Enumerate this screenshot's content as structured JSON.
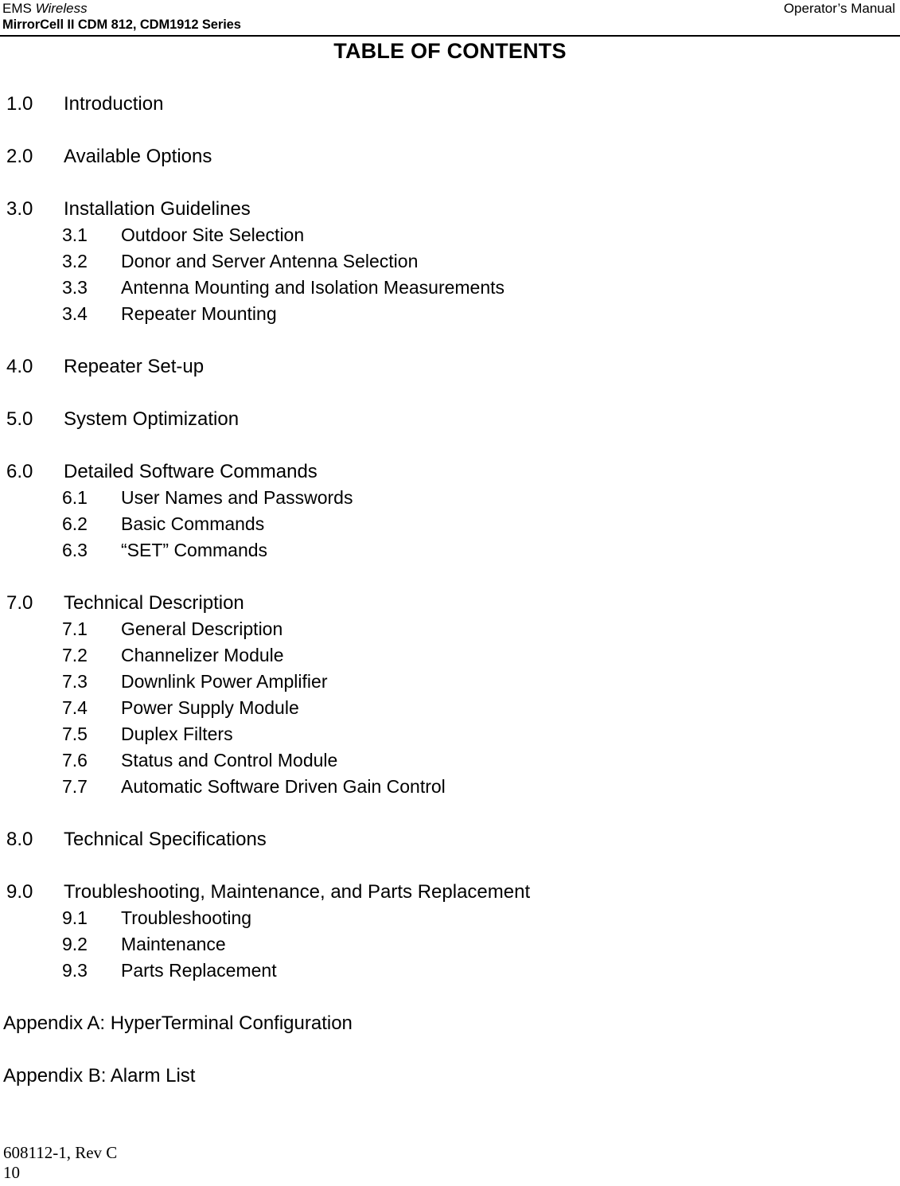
{
  "header": {
    "company_prefix": "EMS ",
    "company_italic": "Wireless",
    "product_line": "MirrorCell II CDM 812, CDM1912 Series",
    "manual_type": "Operator’s Manual"
  },
  "title": "TABLE OF CONTENTS",
  "toc": {
    "groups": [
      {
        "entries": [
          {
            "level": 1,
            "num": "1.0",
            "label": "Introduction"
          }
        ]
      },
      {
        "entries": [
          {
            "level": 1,
            "num": "2.0",
            "label": "Available Options"
          }
        ]
      },
      {
        "entries": [
          {
            "level": 1,
            "num": "3.0",
            "label": "Installation Guidelines"
          },
          {
            "level": 2,
            "num": "3.1",
            "label": "Outdoor Site Selection"
          },
          {
            "level": 2,
            "num": "3.2",
            "label": "Donor and Server Antenna Selection"
          },
          {
            "level": 2,
            "num": "3.3",
            "label": "Antenna Mounting and Isolation Measurements"
          },
          {
            "level": 2,
            "num": "3.4",
            "label": "Repeater Mounting"
          }
        ]
      },
      {
        "entries": [
          {
            "level": 1,
            "num": "4.0",
            "label": "Repeater Set-up"
          }
        ]
      },
      {
        "entries": [
          {
            "level": 1,
            "num": "5.0",
            "label": "System Optimization"
          }
        ]
      },
      {
        "entries": [
          {
            "level": 1,
            "num": "6.0",
            "label": "Detailed Software Commands"
          },
          {
            "level": 2,
            "num": "6.1",
            "label": "User Names and Passwords"
          },
          {
            "level": 2,
            "num": "6.2",
            "label": "Basic Commands"
          },
          {
            "level": 2,
            "num": "6.3",
            "label": "“SET” Commands"
          }
        ]
      },
      {
        "entries": [
          {
            "level": 1,
            "num": "7.0",
            "label": "Technical Description"
          },
          {
            "level": 2,
            "num": "7.1",
            "label": "General Description"
          },
          {
            "level": 2,
            "num": "7.2",
            "label": "Channelizer Module"
          },
          {
            "level": 2,
            "num": "7.3",
            "label": "Downlink Power Amplifier"
          },
          {
            "level": 2,
            "num": "7.4",
            "label": "Power Supply Module"
          },
          {
            "level": 2,
            "num": "7.5",
            "label": "Duplex Filters"
          },
          {
            "level": 2,
            "num": "7.6",
            "label": "Status and Control Module"
          },
          {
            "level": 2,
            "num": "7.7",
            "label": "Automatic Software Driven Gain Control"
          }
        ]
      },
      {
        "entries": [
          {
            "level": 1,
            "num": "8.0",
            "label": "Technical Specifications"
          }
        ]
      },
      {
        "entries": [
          {
            "level": 1,
            "num": "9.0",
            "label": "Troubleshooting, Maintenance, and Parts Replacement"
          },
          {
            "level": 2,
            "num": "9.1",
            "label": "Troubleshooting"
          },
          {
            "level": 2,
            "num": "9.2",
            "label": "Maintenance"
          },
          {
            "level": 2,
            "num": "9.3",
            "label": "Parts Replacement"
          }
        ]
      }
    ],
    "appendices": [
      "Appendix A:  HyperTerminal Configuration",
      "Appendix B: Alarm List"
    ]
  },
  "footer": {
    "document_number": "608112-1, Rev C",
    "page_number": "10"
  }
}
